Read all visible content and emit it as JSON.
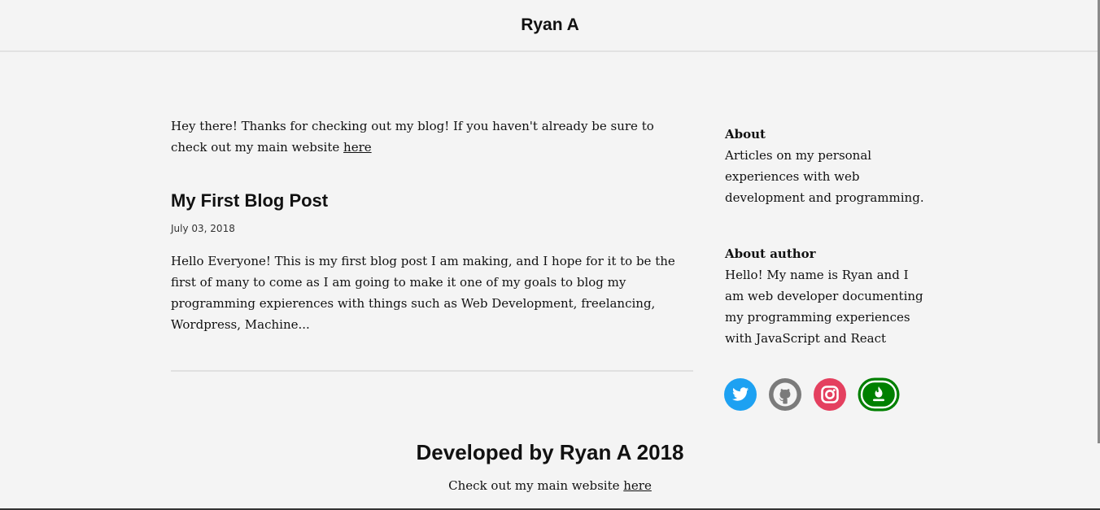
{
  "header": {
    "title": "Ryan A"
  },
  "intro": {
    "text": "Hey there! Thanks for checking out my blog! If you haven't already be sure to check out my main website ",
    "link_label": "here"
  },
  "posts": [
    {
      "title": "My First Blog Post",
      "date": "July 03, 2018",
      "excerpt": "Hello Everyone! This is my first blog post I am making, and I hope for it to be the first of many to come as I am going to make it one of my goals to blog my programming expierences with things such as Web Development, freelancing, Wordpress, Machine..."
    }
  ],
  "sidebar": {
    "about_heading": "About",
    "about_text": "Articles on my personal experiences with web development and programming.",
    "author_heading": "About author",
    "author_text": "Hello! My name is Ryan and I am web developer documenting my programming experiences with JavaScript and React"
  },
  "socials": [
    {
      "icon": "twitter-icon",
      "color": "#1da1f2"
    },
    {
      "icon": "github-icon",
      "color": "#7b7b7b"
    },
    {
      "icon": "instagram-icon",
      "color": "#e4405f"
    },
    {
      "icon": "freecodecamp-icon",
      "color": "#008000"
    }
  ],
  "footer": {
    "title": "Developed by Ryan A 2018",
    "text": "Check out my main website ",
    "link_label": "here"
  }
}
